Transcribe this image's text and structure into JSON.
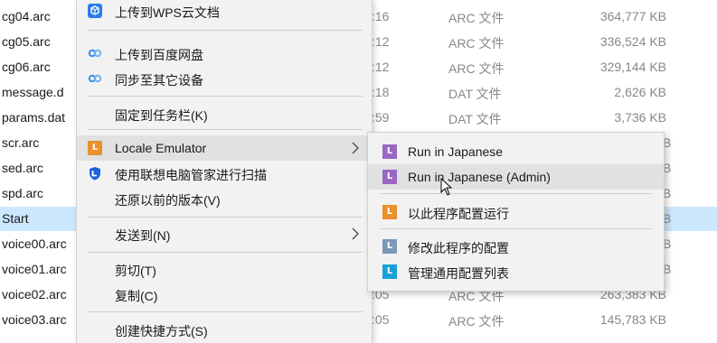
{
  "colors": {
    "selection": "#cce8ff",
    "menu_bg": "#f2f2f2",
    "hover": "#e1e1e1",
    "wps_blue": "#2b7de9",
    "baidu_blue": "#3a8ee6",
    "locale_orange": "#e8912d",
    "purple": "#9a68c4",
    "grey_blue": "#7c98b8",
    "cyan": "#1aa0d8",
    "lenovo_blue": "#1b64d8"
  },
  "files": [
    {
      "name": "cg04.arc",
      "date": ":16",
      "type": "ARC 文件",
      "size": "364,777 KB"
    },
    {
      "name": "cg05.arc",
      "date": ":12",
      "type": "ARC 文件",
      "size": "336,524 KB"
    },
    {
      "name": "cg06.arc",
      "date": ":12",
      "type": "ARC 文件",
      "size": "329,144 KB"
    },
    {
      "name": "message.d",
      "date": ":18",
      "type": "DAT 文件",
      "size": "2,626 KB"
    },
    {
      "name": "params.dat",
      "date": ":59",
      "type": "DAT 文件",
      "size": "3,736 KB"
    },
    {
      "name": "scr.arc",
      "date": "",
      "type": "",
      "size": "",
      "edge": "B"
    },
    {
      "name": "sed.arc",
      "date": "",
      "type": "",
      "size": "",
      "edge": "B"
    },
    {
      "name": "spd.arc",
      "date": "",
      "type": "",
      "size": "",
      "edge": "B"
    },
    {
      "name": "Start",
      "date": "",
      "type": "",
      "size": "",
      "edge": "B"
    },
    {
      "name": "voice00.arc",
      "date": "",
      "type": "",
      "size": "",
      "edge": "B"
    },
    {
      "name": "voice01.arc",
      "date": "",
      "type": "",
      "size": "",
      "edge": "B"
    },
    {
      "name": "voice02.arc",
      "date": ":05",
      "type": "ARC 文件",
      "size": "263,383 KB"
    },
    {
      "name": "voice03.arc",
      "date": ":05",
      "type": "ARC 文件",
      "size": "145,783 KB"
    }
  ],
  "menu": {
    "wps": "上传到WPS云文档",
    "baidu_upload": "上传到百度网盘",
    "baidu_sync": "同步至其它设备",
    "pin_taskbar": "固定到任务栏(K)",
    "locale_emulator": "Locale Emulator",
    "lenovo_scan": "使用联想电脑管家进行扫描",
    "restore_versions": "还原以前的版本(V)",
    "send_to": "发送到(N)",
    "cut": "剪切(T)",
    "copy": "复制(C)",
    "create_shortcut": "创建快捷方式(S)"
  },
  "submenu": {
    "run_japanese": "Run in Japanese",
    "run_japanese_admin": "Run in Japanese (Admin)",
    "run_with_profile": "以此程序配置运行",
    "modify_profile": "修改此程序的配置",
    "manage_profiles": "管理通用配置列表",
    "icon_letter": "L"
  }
}
